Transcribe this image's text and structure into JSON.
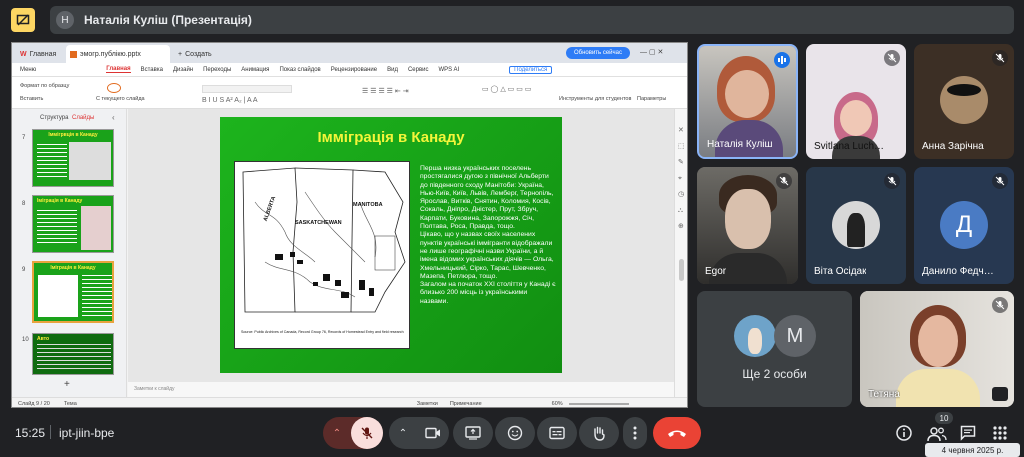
{
  "header": {
    "presenter_initial": "Н",
    "presenter_title": "Наталія Куліш (Презентація)"
  },
  "presentation_window": {
    "tabs": [
      "Главная",
      "эмогр.публікю.pptx",
      "Создать"
    ],
    "update_button": "Обновить сейчас",
    "menu_items": [
      "Меню",
      "Главная",
      "Вставка",
      "Дизайн",
      "Переходы",
      "Анимация",
      "Показ слайдов",
      "Рецензирование",
      "Вид",
      "Сервис",
      "WPS AI"
    ],
    "share_button": "Поделиться",
    "ribbon_items": [
      "Формат по образцу",
      "Вставить",
      "С текущего слайда",
      "Инструменты для студентов",
      "Параметры"
    ],
    "panel_tabs": [
      "Структура",
      "Слайды"
    ],
    "thumbnails": [
      {
        "num": "7",
        "title": "Іммігрвція в Канаду"
      },
      {
        "num": "8",
        "title": "Іміграція в Канаду"
      },
      {
        "num": "9",
        "title": "Іміграція в Канаду"
      },
      {
        "num": "10",
        "title": "Авто"
      }
    ],
    "slide": {
      "title": "Імміграція в Канаду",
      "map_labels": [
        "ALBERTA",
        "SASKATCHEWAN",
        "MANITOBA"
      ],
      "map_caption": "Source: Public Archives of Canada, Record Group 76, Records of Homestead Entry and field research",
      "text": "Перша низка українських поселень простягалися дугою з північної Альберти до південного сходу Манітоби: Україна, Нью-Київ, Київ, Львів, Лемберг, Тернопіль, Ярослав, Витків, Снятин, Коломия, Косів, Сокаль, Дніпро, Дністер, Прут, Збруч, Карпати, Буковина, Запорожжя, Січ, Полтава, Роса, Правда, тощо.\nЦікаво, що у назвах своїх населених пунктів українські іммігранти відображали не лише географічні назви України, а й імена відомих українських діячів — Ольга, Хмельницький, Сірко, Тарас, Шевченко, Мазепа, Петлюра, тощо.\nЗагалом на початок ХХІ століття у Канаді є близько 200 місць із українськими назвами."
    },
    "notes_placeholder": "Заметки к слайду",
    "status": {
      "slide_count": "Слайд 9 / 20",
      "theme": "Тема",
      "notes": "Заметки",
      "comment": "Примечание",
      "zoom": "60%"
    }
  },
  "participants": [
    {
      "name": "Наталія Куліш",
      "speaking": true
    },
    {
      "name": "Svitlana Luch…",
      "muted": true
    },
    {
      "name": "Анна Зарічна",
      "muted": true
    },
    {
      "name": "Egor",
      "muted": true
    },
    {
      "name": "Віта Осідак",
      "muted": true
    },
    {
      "name": "Данило Федч…",
      "muted": true,
      "initial": "Д"
    },
    {
      "name": "Ще 2 особи",
      "initial": "M"
    },
    {
      "name": "Тетяна",
      "muted": true
    }
  ],
  "bottom": {
    "time": "15:25",
    "meeting_code": "ipt-jiin-bpe",
    "people_count": "10",
    "date_tooltip": "4 червня 2025 р."
  },
  "colors": {
    "bg": "#202124",
    "slide_green": "#16a016",
    "slide_title": "#f3f53a",
    "end_call": "#ea4335",
    "mic_muted_bg": "#f9dedc"
  }
}
